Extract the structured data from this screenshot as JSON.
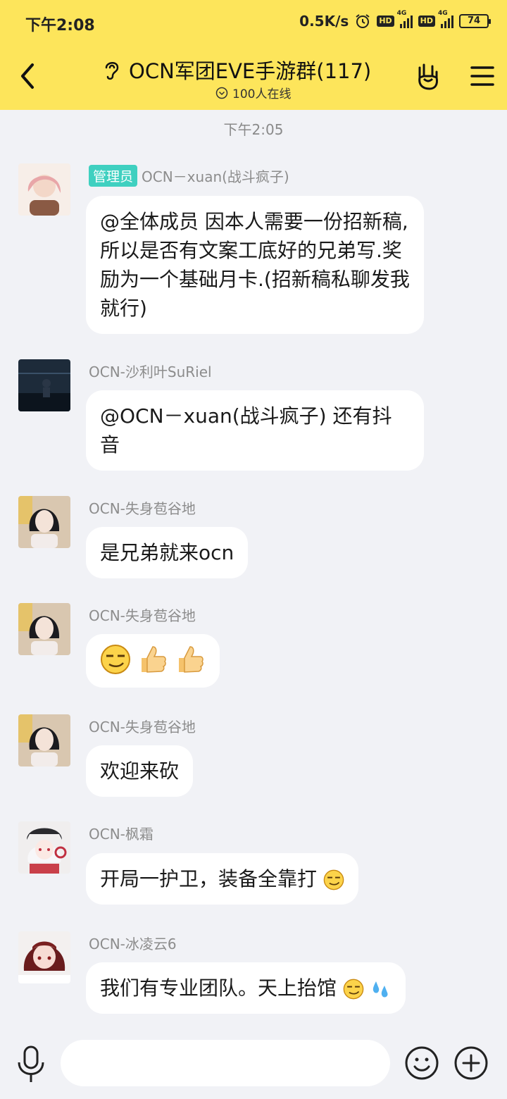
{
  "status_bar": {
    "time": "下午2:08",
    "net_speed": "0.5K/s",
    "battery": "74",
    "hd_label": "HD",
    "net_type": "4G"
  },
  "header": {
    "title": "OCN军团EVE手游群(117)",
    "online": "100人在线"
  },
  "chat": {
    "timestamp": "下午2:05",
    "messages": [
      {
        "sender": "OCN－xuan(战斗疯子)",
        "badge": "管理员",
        "text": "@全体成员 因本人需要一份招新稿,所以是否有文案工底好的兄弟写.奖励为一个基础月卡.(招新稿私聊发我就行)"
      },
      {
        "sender": "OCN-沙利叶SuRiel",
        "text": "@OCN－xuan(战斗疯子) 还有抖音"
      },
      {
        "sender": "OCN-失身苞谷地",
        "text": "是兄弟就来ocn"
      },
      {
        "sender": "OCN-失身苞谷地",
        "text": ""
      },
      {
        "sender": "OCN-失身苞谷地",
        "text": "欢迎来砍"
      },
      {
        "sender": "OCN-枫霜",
        "text": "开局一护卫，装备全靠打"
      },
      {
        "sender": "OCN-冰凌云6",
        "text": "我们有专业团队。天上抬馆"
      }
    ]
  },
  "icons": {
    "back": "chevron-left-icon",
    "ear": "ear-icon",
    "online": "chevron-circle-icon",
    "hand": "rock-hand-icon",
    "menu": "menu-icon",
    "mic": "microphone-icon",
    "emoji": "smiley-icon",
    "plus": "plus-circle-icon"
  },
  "colors": {
    "header_bg": "#fde55b",
    "chat_bg": "#f1f2f6",
    "admin_badge": "#3fd0c0"
  },
  "input": {
    "placeholder": ""
  }
}
